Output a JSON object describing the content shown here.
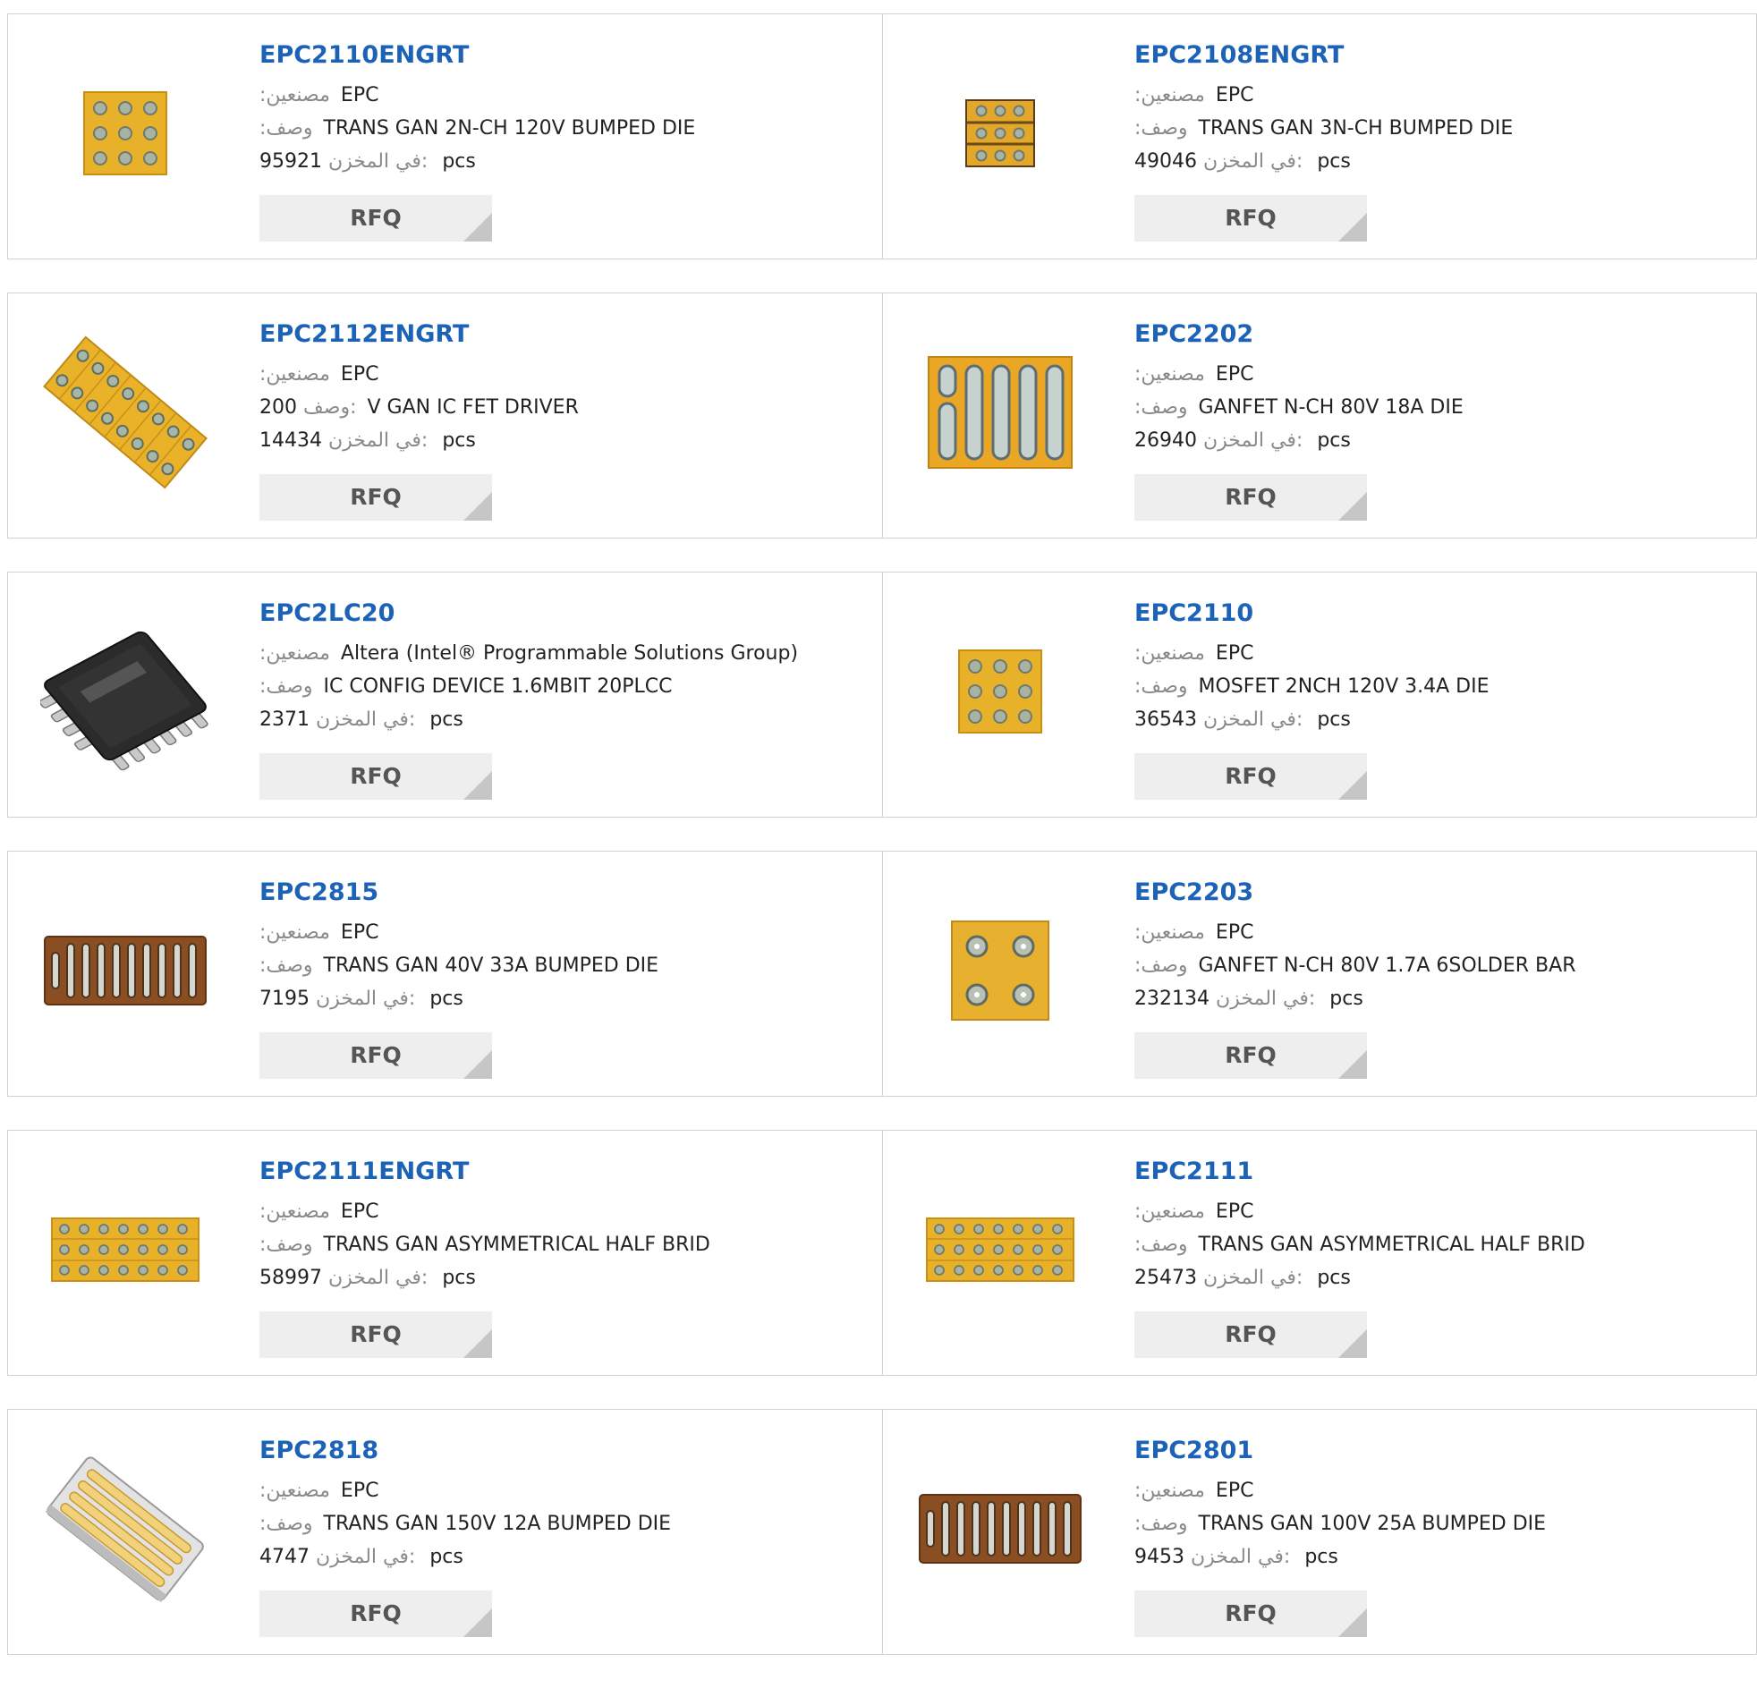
{
  "labels": {
    "manufacturer": ":مصنعين",
    "description": ":وصف",
    "description_alt": "وصف:",
    "stock": "في المخزن:",
    "pcs": "pcs",
    "rfq": "RFQ"
  },
  "colors": {
    "link": "#1c63b7",
    "border": "#d2d2d2",
    "rfq_bg": "#eeeeee",
    "die": "#e8b12a"
  },
  "products": [
    {
      "part": "EPC2110ENGRT",
      "manufacturer": "EPC",
      "description": "TRANS GAN 2N-CH 120V BUMPED DIE",
      "stock": "95921",
      "icon": "die-3x3-icon"
    },
    {
      "part": "EPC2108ENGRT",
      "manufacturer": "EPC",
      "description": "TRANS GAN 3N-CH BUMPED DIE",
      "stock": "49046",
      "icon": "die-3x3-small-icon"
    },
    {
      "part": "EPC2112ENGRT",
      "manufacturer": "EPC",
      "description_prefix": "200",
      "description": "V GAN IC FET DRIVER",
      "stock": "14434",
      "icon": "die-rotated-icon"
    },
    {
      "part": "EPC2202",
      "manufacturer": "EPC",
      "description": "GANFET N-CH 80V 18A DIE",
      "stock": "26940",
      "icon": "die-bars-icon"
    },
    {
      "part": "EPC2LC20",
      "manufacturer": "Altera (Intel® Programmable Solutions Group)",
      "description": "IC CONFIG DEVICE 1.6MBIT 20PLCC",
      "stock": "2371",
      "icon": "plcc-chip-icon"
    },
    {
      "part": "EPC2110",
      "manufacturer": "EPC",
      "description": "MOSFET 2NCH 120V 3.4A DIE",
      "stock": "36543",
      "icon": "die-3x3-icon"
    },
    {
      "part": "EPC2815",
      "manufacturer": "EPC",
      "description": "TRANS GAN 40V 33A BUMPED DIE",
      "stock": "7195",
      "icon": "die-strips-icon"
    },
    {
      "part": "EPC2203",
      "manufacturer": "EPC",
      "description": "GANFET N-CH 80V 1.7A 6SOLDER BAR",
      "stock": "232134",
      "icon": "die-2x2-icon"
    },
    {
      "part": "EPC2111ENGRT",
      "manufacturer": "EPC",
      "description": "TRANS GAN ASYMMETRICAL HALF BRID",
      "stock": "58997",
      "icon": "die-3x7-icon"
    },
    {
      "part": "EPC2111",
      "manufacturer": "EPC",
      "description": "TRANS GAN ASYMMETRICAL HALF BRID",
      "stock": "25473",
      "icon": "die-3x7-icon"
    },
    {
      "part": "EPC2818",
      "manufacturer": "EPC",
      "description": "TRANS GAN 150V 12A BUMPED DIE",
      "stock": "4747",
      "icon": "die-angled-bars-icon"
    },
    {
      "part": "EPC2801",
      "manufacturer": "EPC",
      "description": "TRANS GAN 100V 25A BUMPED DIE",
      "stock": "9453",
      "icon": "die-strips-icon"
    }
  ]
}
